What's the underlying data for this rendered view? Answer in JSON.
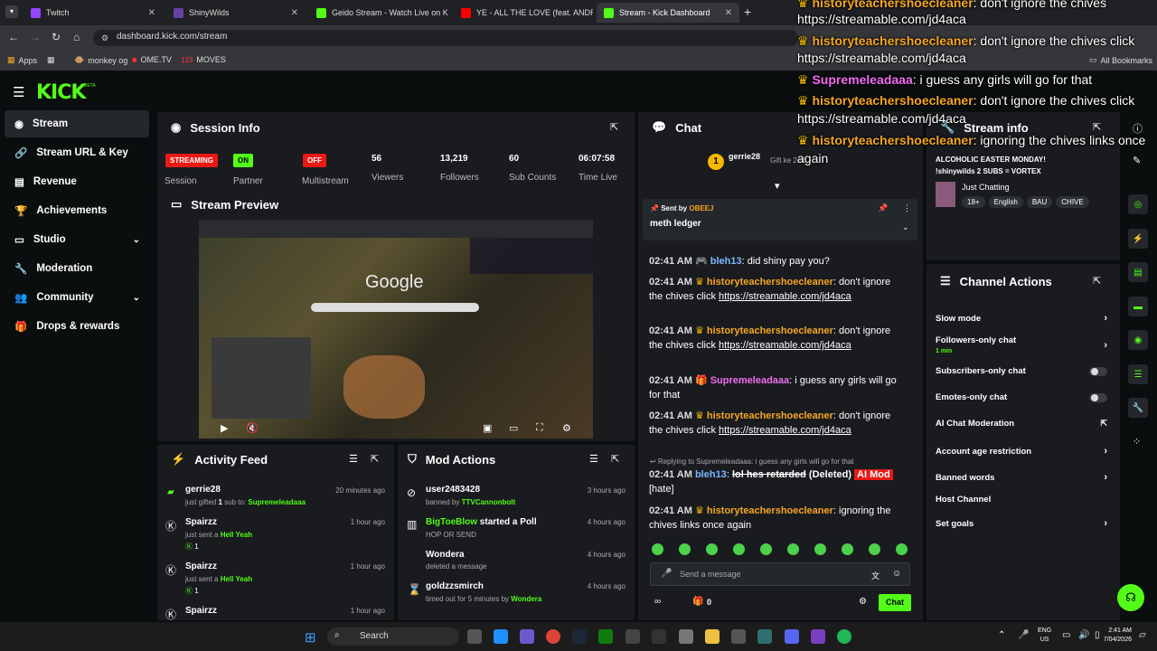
{
  "browser": {
    "tabs": [
      {
        "title": "Twitch",
        "color": "#9146ff"
      },
      {
        "title": "ShinyWilds",
        "color": "#6441a5"
      },
      {
        "title": "Geido Stream - Watch Live on K",
        "color": "#53fc18"
      },
      {
        "title": "YE - ALL THE LOVE (feat. ANDR",
        "color": "#ff0000"
      },
      {
        "title": "Stream - Kick Dashboard",
        "color": "#53fc18"
      }
    ],
    "new_tab": "+",
    "url": "dashboard.kick.com/stream",
    "bookmarks": [
      "Apps",
      "monkey og",
      "OME.TV",
      "MOVES"
    ],
    "all_bookmarks": "All Bookmarks"
  },
  "header": {
    "logo": "KICK",
    "beta": "BETA"
  },
  "sidebar": {
    "items": [
      {
        "label": "Stream",
        "icon": "broadcast-icon",
        "active": true
      },
      {
        "label": "Stream URL & Key",
        "icon": "link-icon"
      },
      {
        "label": "Revenue",
        "icon": "chart-icon"
      },
      {
        "label": "Achievements",
        "icon": "trophy-icon"
      },
      {
        "label": "Studio",
        "icon": "monitor-icon",
        "expandable": true
      },
      {
        "label": "Moderation",
        "icon": "wrench-icon"
      },
      {
        "label": "Community",
        "icon": "people-icon",
        "expandable": true
      },
      {
        "label": "Drops & rewards",
        "icon": "gift-icon"
      }
    ]
  },
  "session": {
    "title": "Session Info",
    "session_badge": "STREAMING",
    "session_label": "Session",
    "partner_badge": "ON",
    "partner_label": "Partner",
    "multistream_badge": "OFF",
    "multistream_label": "Multistream",
    "viewers": "56",
    "viewers_label": "Viewers",
    "followers": "13,219",
    "followers_label": "Followers",
    "subs": "60",
    "subs_label": "Sub Counts",
    "time_live": "06:07:58",
    "time_label": "Time Live"
  },
  "preview": {
    "title": "Stream Preview",
    "search_word": "Google"
  },
  "activity": {
    "title": "Activity Feed",
    "items": [
      {
        "user": "gerrie28",
        "pre": "just gifted ",
        "count": "1",
        "mid": " sub to: ",
        "target": "Supremeleadaaa",
        "time": "20 minutes ago"
      },
      {
        "user": "Spairzz",
        "pre": "just sent a ",
        "target": "Hell Yeah",
        "count": "1",
        "time": "1 hour ago"
      },
      {
        "user": "Spairzz",
        "pre": "just sent a ",
        "target": "Hell Yeah",
        "count": "1",
        "time": "1 hour ago"
      },
      {
        "user": "Spairzz",
        "time": "1 hour ago"
      }
    ]
  },
  "mod": {
    "title": "Mod Actions",
    "items": [
      {
        "user": "user2483428",
        "action": "banned by ",
        "by": "TTVCannonbolt",
        "time": "3 hours ago"
      },
      {
        "user": "BigToeBlow",
        "action_inline": " started a Poll",
        "detail": "HOP OR SEND",
        "time": "4 hours ago"
      },
      {
        "user": "Wondera",
        "detail": "deleted a message",
        "time": "4 hours ago"
      },
      {
        "user": "goldzzsmirch",
        "action": "timed out for 5 minutes by ",
        "by": "Wondera",
        "time": "4 hours ago"
      }
    ]
  },
  "chat": {
    "title": "Chat",
    "gifter": "gerrie28",
    "gifter_count": "1",
    "gift_text": "Gift",
    "gift_suffix": "ke 2nd",
    "pinned_label": "Sent by",
    "pinned_by": "OBEEJ",
    "pinned_message": "meth ledger",
    "partial_top": "02:41 AM",
    "partial_top_text": "bleh13: did shiny pay you?",
    "messages": [
      {
        "time": "02:41 AM",
        "user": "bleh13",
        "color": "blue",
        "text": ": did shiny pay you?"
      },
      {
        "time": "02:41 AM",
        "user": "historyteachershoecleaner",
        "color": "orange",
        "text": ": don't ignore the chives click ",
        "link": "https://streamable.com/jd4aca"
      },
      {
        "time": "02:41 AM",
        "user": "historyteachershoecleaner",
        "color": "orange",
        "text": ": don't ignore the chives click ",
        "link": "https://streamable.com/jd4aca"
      },
      {
        "time": "02:41 AM",
        "user": "Supremeleadaaa",
        "color": "pink",
        "text": ": i guess any girls will go for that"
      },
      {
        "time": "02:41 AM",
        "user": "historyteachershoecleaner",
        "color": "orange",
        "text": ": don't ignore the chives click ",
        "link": "https://streamable.com/jd4aca"
      }
    ],
    "reply_to": "Replying to Supremeleadaaa: i guess any girls will go for that",
    "deleted_time": "02:41 AM",
    "deleted_user": "bleh13",
    "deleted_text": "lol hes retarded",
    "deleted_label": "(Deleted)",
    "ai_mod": "AI Mod",
    "hate": "[hate]",
    "last_time": "02:41 AM",
    "last_user": "historyteachershoecleaner",
    "last_text": ": ignoring the chives links once again",
    "placeholder": "Send a message",
    "points": "0",
    "send": "Chat"
  },
  "stream_info": {
    "title": "Stream info",
    "stream_title": "ALCOHOLIC EASTER MONDAY! !shinywilds 2 SUBS = VORTEX",
    "category": "Just Chatting",
    "tags": [
      "18+",
      "English",
      "BAU",
      "CHIVE"
    ]
  },
  "channel_actions": {
    "title": "Channel Actions",
    "items": [
      {
        "label": "Slow mode",
        "kind": "arrow"
      },
      {
        "label": "Followers-only chat",
        "sub": "1 min",
        "kind": "arrow"
      },
      {
        "label": "Subscribers-only chat",
        "kind": "toggle"
      },
      {
        "label": "Emotes-only chat",
        "kind": "toggle"
      },
      {
        "label": "AI Chat Moderation",
        "kind": "external"
      },
      {
        "label": "Account age restriction",
        "kind": "arrow"
      },
      {
        "label": "Banned words",
        "kind": "arrow"
      },
      {
        "label": "Host Channel",
        "kind": "none"
      },
      {
        "label": "Set goals",
        "kind": "arrow"
      }
    ]
  },
  "overlay": {
    "lines": [
      {
        "user": "historyteachershoecleaner",
        "text": ": don't ignore the chives",
        "cont": "https://streamable.com/jd4aca",
        "color": "#f5a623"
      },
      {
        "user": "historyteachershoecleaner",
        "text": ": don't ignore the chives click",
        "cont": "https://streamable.com/jd4aca",
        "color": "#f5a623"
      },
      {
        "user": "Supremeleadaaa",
        "text": ": i guess any girls will go for that",
        "color": "#f06ef0"
      },
      {
        "user": "historyteachershoecleaner",
        "text": ": don't ignore the chives click",
        "cont": "https://streamable.com/jd4aca",
        "color": "#f5a623"
      },
      {
        "user": "historyteachershoecleaner",
        "text": ": ignoring the chives links once",
        "cont": "again",
        "color": "#f5a623"
      }
    ]
  },
  "taskbar": {
    "search": "Search",
    "lang": "ENG",
    "region": "US",
    "time": "2:41 AM",
    "date": "7/04/2026"
  }
}
